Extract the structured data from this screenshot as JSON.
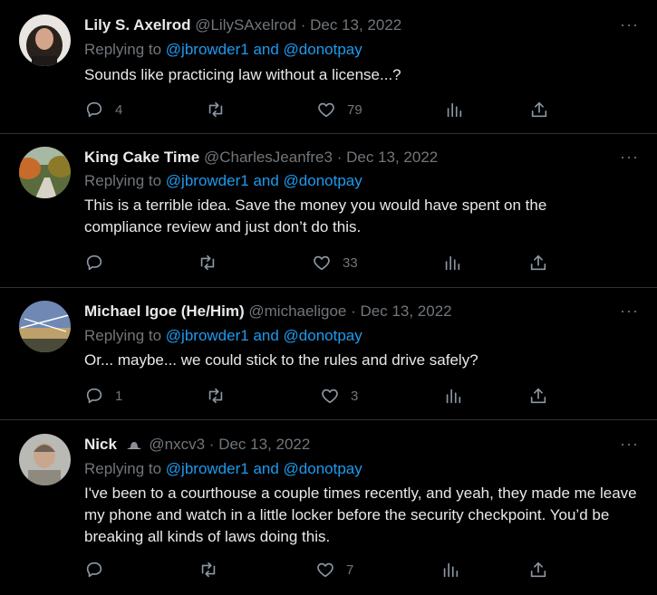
{
  "tweets": [
    {
      "name": "Lily S. Axelrod",
      "handle": "@LilySAxelrod",
      "date": "Dec 13, 2022",
      "reply_prefix": "Replying to",
      "reply_user1": "@jbrowder1",
      "reply_and": "and",
      "reply_user2": "@donotpay",
      "text": "Sounds like practicing law without a license...?",
      "replies": "4",
      "retweets": "",
      "likes": "79"
    },
    {
      "name": "King Cake Time",
      "handle": "@CharlesJeanfre3",
      "date": "Dec 13, 2022",
      "reply_prefix": "Replying to",
      "reply_user1": "@jbrowder1",
      "reply_and": "and",
      "reply_user2": "@donotpay",
      "text": "This is a terrible idea.  Save the money you would have spent on the compliance review and just don’t do this.",
      "replies": "",
      "retweets": "",
      "likes": "33"
    },
    {
      "name": "Michael Igoe (He/Him)",
      "handle": "@michaeligoe",
      "date": "Dec 13, 2022",
      "reply_prefix": "Replying to",
      "reply_user1": "@jbrowder1",
      "reply_and": "and",
      "reply_user2": "@donotpay",
      "text": "Or... maybe... we could stick to the rules and drive safely?",
      "replies": "1",
      "retweets": "",
      "likes": "3"
    },
    {
      "name": "Nick",
      "handle": "@nxcv3",
      "date": "Dec 13, 2022",
      "reply_prefix": "Replying to",
      "reply_user1": "@jbrowder1",
      "reply_and": "and",
      "reply_user2": "@donotpay",
      "text": "I've been to a courthouse a couple times recently, and yeah, they made me leave my phone and watch in a little locker before the security checkpoint. You’d be breaking all kinds of laws doing this.",
      "replies": "",
      "retweets": "",
      "likes": "7"
    }
  ],
  "separator": "·",
  "more_glyph": "···",
  "icons": [
    "reply-icon",
    "retweet-icon",
    "like-icon",
    "views-icon",
    "share-icon"
  ],
  "colors": {
    "background": "#000000",
    "text": "#e7e9ea",
    "muted": "#71767b",
    "link": "#1d9bf0",
    "border": "#2f3336"
  }
}
